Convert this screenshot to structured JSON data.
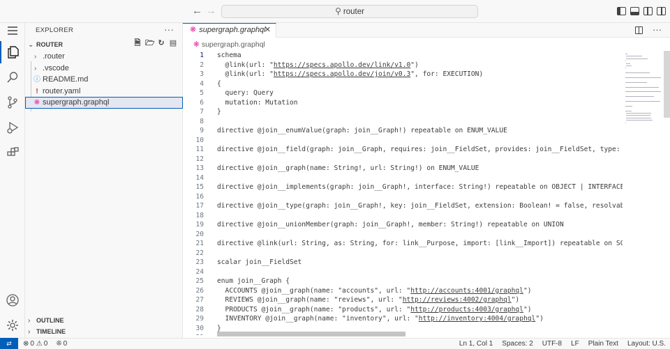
{
  "titlebar": {
    "search_text": "router",
    "back_icon": "arrow-left-icon",
    "forward_icon": "arrow-right-icon"
  },
  "sidebar": {
    "title": "EXPLORER",
    "more": "···",
    "folder": "ROUTER",
    "items": [
      {
        "label": ".router",
        "type": "folder"
      },
      {
        "label": ".vscode",
        "type": "folder"
      },
      {
        "label": "README.md",
        "type": "info"
      },
      {
        "label": "router.yaml",
        "type": "yaml"
      },
      {
        "label": "supergraph.graphql",
        "type": "graphql"
      }
    ],
    "outline": "OUTLINE",
    "timeline": "TIMELINE"
  },
  "editor": {
    "tab_label": "supergraph.graphql",
    "breadcrumb": "supergraph.graphql",
    "lines": [
      "schema",
      "  @link(url: \"https://specs.apollo.dev/link/v1.0\")",
      "  @link(url: \"https://specs.apollo.dev/join/v0.3\", for: EXECUTION)",
      "{",
      "  query: Query",
      "  mutation: Mutation",
      "}",
      "",
      "directive @join__enumValue(graph: join__Graph!) repeatable on ENUM_VALUE",
      "",
      "directive @join__field(graph: join__Graph, requires: join__FieldSet, provides: join__FieldSet, type: String",
      "",
      "directive @join__graph(name: String!, url: String!) on ENUM_VALUE",
      "",
      "directive @join__implements(graph: join__Graph!, interface: String!) repeatable on OBJECT | INTERFACE",
      "",
      "directive @join__type(graph: join__Graph!, key: join__FieldSet, extension: Boolean! = false, resolvable: Bo",
      "",
      "directive @join__unionMember(graph: join__Graph!, member: String!) repeatable on UNION",
      "",
      "directive @link(url: String, as: String, for: link__Purpose, import: [link__Import]) repeatable on SCHEMA",
      "",
      "scalar join__FieldSet",
      "",
      "enum join__Graph {",
      "  ACCOUNTS @join__graph(name: \"accounts\", url: \"http://accounts:4001/graphql\")",
      "  REVIEWS @join__graph(name: \"reviews\", url: \"http://reviews:4002/graphql\")",
      "  PRODUCTS @join__graph(name: \"products\", url: \"http://products:4003/graphql\")",
      "  INVENTORY @join__graph(name: \"inventory\", url: \"http://inventory:4004/graphql\")",
      "}",
      ""
    ]
  },
  "statusbar": {
    "errors": "0",
    "warnings": "0",
    "ports": "0",
    "position": "Ln 1, Col 1",
    "spaces": "Spaces: 2",
    "encoding": "UTF-8",
    "eol": "LF",
    "language": "Plain Text",
    "layout": "Layout: U.S."
  }
}
